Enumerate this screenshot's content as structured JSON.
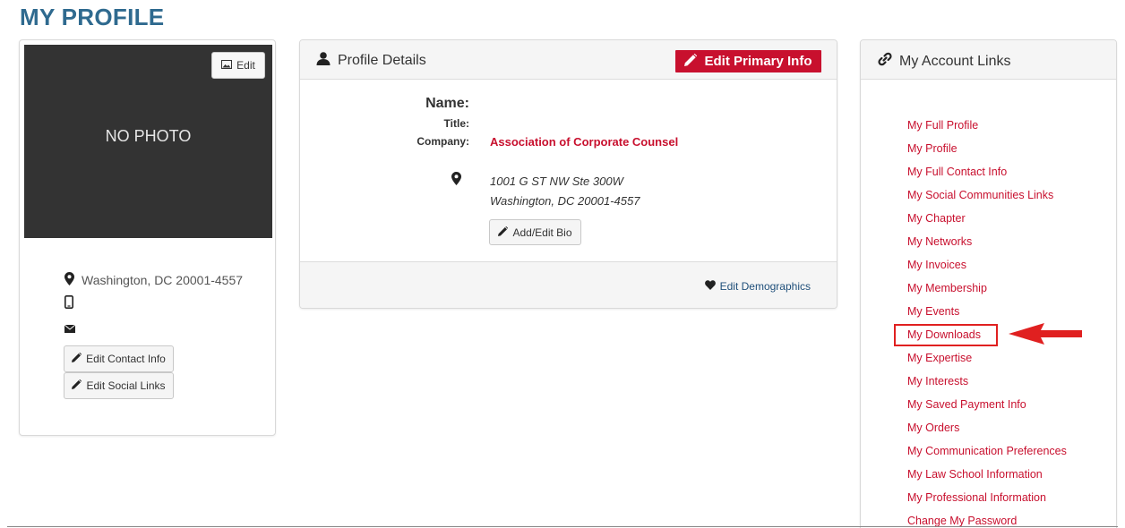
{
  "page": {
    "title": "MY PROFILE"
  },
  "photo": {
    "placeholder": "NO PHOTO",
    "edit_label": "Edit"
  },
  "contact": {
    "location": "Washington, DC 20001-4557",
    "edit_contact_label": "Edit Contact Info",
    "edit_social_label": "Edit Social Links"
  },
  "profile": {
    "header": "Profile Details",
    "edit_primary_label": "Edit Primary Info",
    "name_label": "Name:",
    "title_label": "Title:",
    "company_label": "Company:",
    "company_value": "Association of Corporate Counsel",
    "address_line1": "1001 G ST NW Ste 300W",
    "address_line2": "Washington, DC 20001-4557",
    "add_bio_label": "Add/Edit Bio",
    "edit_demographics_label": "Edit Demographics"
  },
  "account_links": {
    "header": "My Account Links",
    "items": [
      "My Full Profile",
      "My Profile",
      "My Full Contact Info",
      "My Social Communities Links",
      "My Chapter",
      "My Networks",
      "My Invoices",
      "My Membership",
      "My Events",
      "My Downloads",
      "My Expertise",
      "My Interests",
      "My Saved Payment Info",
      "My Orders",
      "My Communication Preferences",
      "My Law School Information",
      "My Professional Information",
      "Change My Password"
    ]
  },
  "colors": {
    "accent": "#c8102e",
    "title": "#2f6a8f",
    "photo_bg": "#333333",
    "annotation": "#e02020"
  }
}
